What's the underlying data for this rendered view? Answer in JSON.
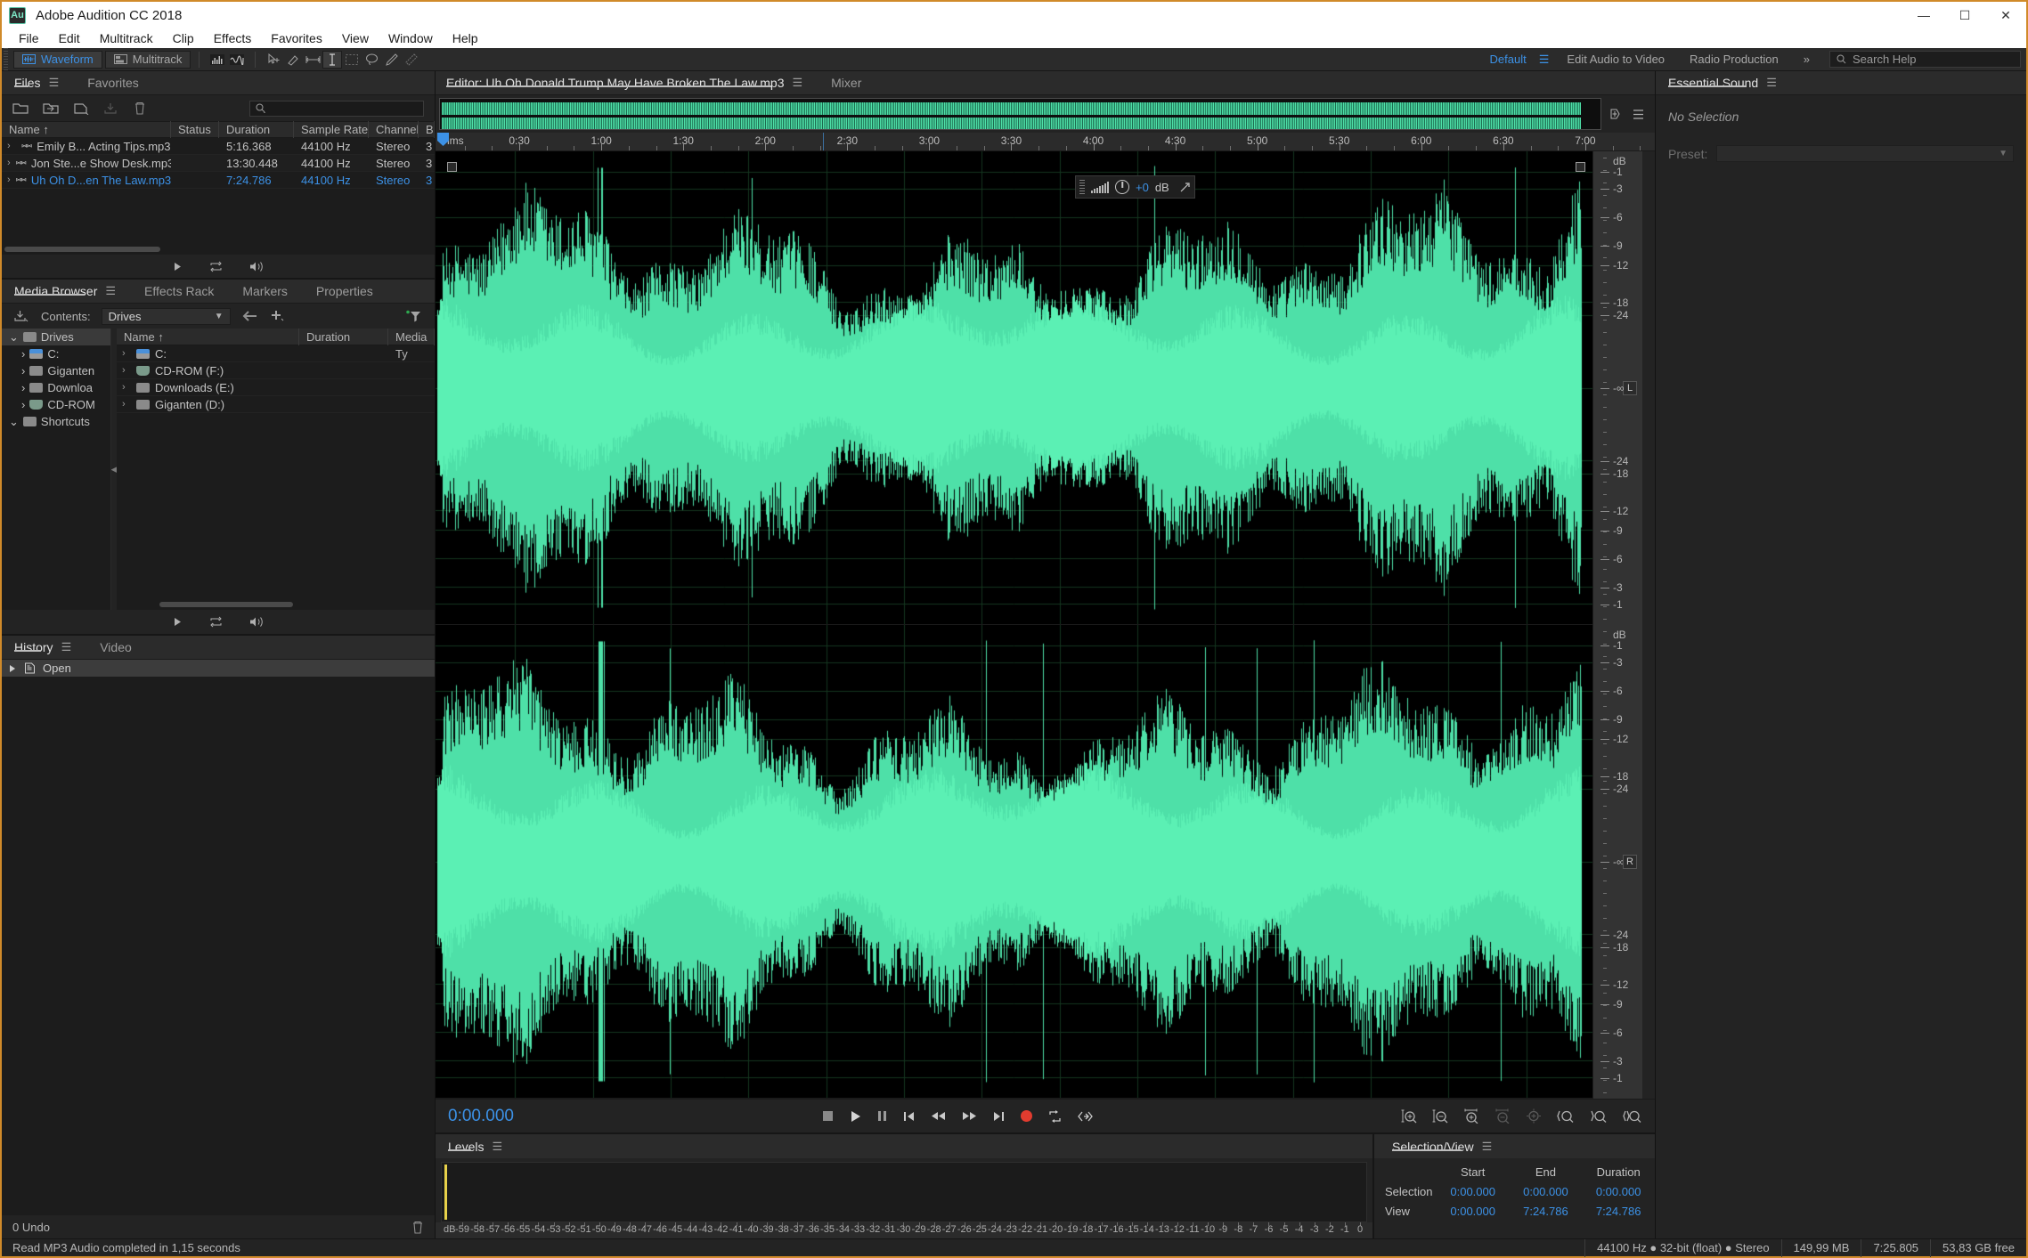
{
  "window": {
    "title": "Adobe Audition CC 2018",
    "logo_text": "Au",
    "minimize": "—",
    "maximize": "☐",
    "close": "✕"
  },
  "menu": [
    "File",
    "Edit",
    "Multitrack",
    "Clip",
    "Effects",
    "Favorites",
    "View",
    "Window",
    "Help"
  ],
  "toolbar": {
    "mode_waveform": "Waveform",
    "mode_multitrack": "Multitrack",
    "workspace_default": "Default",
    "workspace_edit_audio_to_video": "Edit Audio to Video",
    "workspace_radio_production": "Radio Production",
    "workspace_more": "»",
    "search_placeholder": "Search Help",
    "search_value": "Search Help"
  },
  "files_panel": {
    "tabs": [
      {
        "label": "Files",
        "active": true,
        "menu": "☰"
      },
      {
        "label": "Favorites",
        "active": false
      }
    ],
    "search_value": "",
    "columns": [
      "Name",
      "Status",
      "Duration",
      "Sample Rate",
      "Channels",
      "Bi"
    ],
    "sort_arrow": "↑",
    "rows": [
      {
        "name": "Emily B... Acting Tips.mp3",
        "status": "",
        "duration": "5:16.368",
        "sample_rate": "44100 Hz",
        "channels": "Stereo",
        "bit": "3",
        "selected": false
      },
      {
        "name": "Jon Ste...e Show Desk.mp3",
        "status": "",
        "duration": "13:30.448",
        "sample_rate": "44100 Hz",
        "channels": "Stereo",
        "bit": "3",
        "selected": false
      },
      {
        "name": "Uh Oh D...en The Law.mp3",
        "status": "",
        "duration": "7:24.786",
        "sample_rate": "44100 Hz",
        "channels": "Stereo",
        "bit": "3",
        "selected": true
      }
    ]
  },
  "media_browser": {
    "tabs": [
      {
        "label": "Media Browser",
        "active": true,
        "menu": "☰"
      },
      {
        "label": "Effects Rack",
        "active": false
      },
      {
        "label": "Markers",
        "active": false
      },
      {
        "label": "Properties",
        "active": false
      }
    ],
    "contents_label": "Contents:",
    "contents_value": "Drives",
    "tree": [
      {
        "label": "Drives",
        "level": 0,
        "expanded": true,
        "highlight": true
      },
      {
        "label": "C:",
        "level": 1,
        "expanded": false,
        "kind": "hdd-blue"
      },
      {
        "label": "Giganten",
        "level": 1,
        "expanded": false,
        "kind": "hdd"
      },
      {
        "label": "Downloa",
        "level": 1,
        "expanded": false,
        "kind": "hdd"
      },
      {
        "label": "CD-ROM",
        "level": 1,
        "expanded": false,
        "kind": "cd"
      },
      {
        "label": "Shortcuts",
        "level": 0,
        "expanded": true,
        "kind": "shortcut"
      }
    ],
    "list_columns": [
      "Name",
      "Duration",
      "Media Ty"
    ],
    "list_sort_arrow": "↑",
    "list_rows": [
      {
        "name": "C:",
        "duration": "",
        "media_type": "",
        "kind": "hdd-blue"
      },
      {
        "name": "CD-ROM (F:)",
        "duration": "",
        "media_type": "",
        "kind": "cd"
      },
      {
        "name": "Downloads (E:)",
        "duration": "",
        "media_type": "",
        "kind": "hdd"
      },
      {
        "name": "Giganten (D:)",
        "duration": "",
        "media_type": "",
        "kind": "hdd"
      }
    ]
  },
  "history_panel": {
    "tabs": [
      {
        "label": "History",
        "active": true,
        "menu": "☰"
      },
      {
        "label": "Video",
        "active": false
      }
    ],
    "items": [
      {
        "label": "Open"
      }
    ],
    "undo_count": "0 Undo"
  },
  "editor": {
    "tabs": [
      {
        "label": "Editor: Uh Oh Donald Trump May Have Broken The Law.mp3",
        "active": true,
        "menu": "☰"
      },
      {
        "label": "Mixer",
        "active": false
      }
    ],
    "hud": {
      "gain_value": "+0",
      "gain_unit": "dB"
    },
    "ruler_labels": [
      "hms",
      "0:30",
      "1:00",
      "1:30",
      "2:00",
      "2:30",
      "3:00",
      "3:30",
      "4:00",
      "4:30",
      "5:00",
      "5:30",
      "6:00",
      "6:30",
      "7:00"
    ],
    "db_scale_label": "dB",
    "db_scale_top": [
      "-1",
      "-3",
      "-6",
      "-9",
      "-12",
      "-18",
      "-24",
      "-∞",
      "-24",
      "-18",
      "-12",
      "-9",
      "-6",
      "-3",
      "-1"
    ],
    "channel_left": "L",
    "channel_right": "R",
    "timecode": "0:00.000"
  },
  "levels_panel": {
    "tabs": [
      {
        "label": "Levels",
        "active": true,
        "menu": "☰"
      }
    ],
    "scale_unit": "dB",
    "scale_values": [
      "-59",
      "-58",
      "-57",
      "-56",
      "-55",
      "-54",
      "-53",
      "-52",
      "-51",
      "-50",
      "-49",
      "-48",
      "-47",
      "-46",
      "-45",
      "-44",
      "-43",
      "-42",
      "-41",
      "-40",
      "-39",
      "-38",
      "-37",
      "-36",
      "-35",
      "-34",
      "-33",
      "-32",
      "-31",
      "-30",
      "-29",
      "-28",
      "-27",
      "-26",
      "-25",
      "-24",
      "-23",
      "-22",
      "-21",
      "-20",
      "-19",
      "-18",
      "-17",
      "-16",
      "-15",
      "-14",
      "-13",
      "-12",
      "-11",
      "-10",
      "-9",
      "-8",
      "-7",
      "-6",
      "-5",
      "-4",
      "-3",
      "-2",
      "-1",
      "0"
    ]
  },
  "selection_view": {
    "tabs": [
      {
        "label": "Selection/View",
        "active": true,
        "menu": "☰"
      }
    ],
    "columns": [
      "",
      "Start",
      "End",
      "Duration"
    ],
    "rows": [
      {
        "label": "Selection",
        "start": "0:00.000",
        "end": "0:00.000",
        "duration": "0:00.000"
      },
      {
        "label": "View",
        "start": "0:00.000",
        "end": "7:24.786",
        "duration": "7:24.786"
      }
    ]
  },
  "essential_sound": {
    "tabs": [
      {
        "label": "Essential Sound",
        "active": true,
        "menu": "☰"
      }
    ],
    "no_selection": "No Selection",
    "preset_label": "Preset:",
    "preset_value": ""
  },
  "status_bar": {
    "message": "Read MP3 Audio completed in 1,15 seconds",
    "format": "44100 Hz ● 32-bit (float) ● Stereo",
    "file_size": "149,99 MB",
    "duration": "7:25.805",
    "free_space": "53,83 GB free"
  },
  "colors": {
    "accent_blue": "#3c91e6",
    "waveform_green": "#4ee0a8",
    "record_red": "#e23c2f",
    "window_border": "#d08a2a"
  }
}
